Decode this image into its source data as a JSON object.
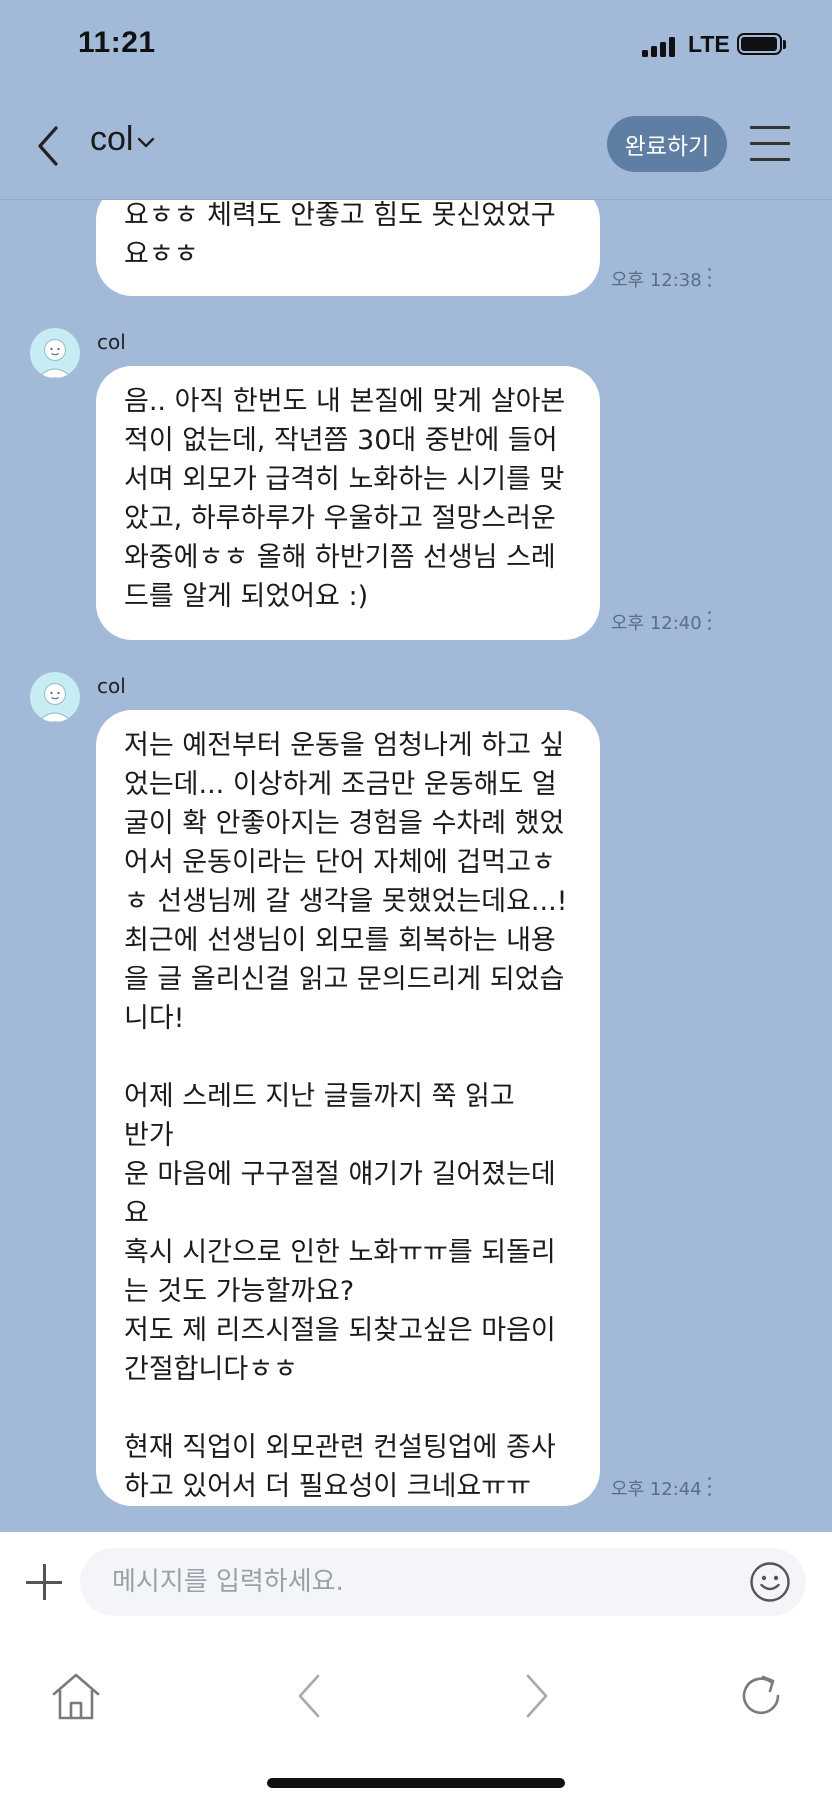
{
  "status_bar": {
    "time": "11:21",
    "network": "LTE",
    "icons": [
      "signal-icon",
      "battery-icon"
    ]
  },
  "header": {
    "back_icon": "chevron-left-icon",
    "title": "col",
    "title_icon": "chevron-down-icon",
    "done_label": "완료하기",
    "menu_icon": "hamburger-icon"
  },
  "messages": [
    {
      "sender": "",
      "text": "요ㅎㅎ 체력도 안좋고 힘도 못신었었구\n요ㅎㅎ",
      "time": "오후 12:38"
    },
    {
      "sender": "col",
      "text": "음.. 아직 한번도 내 본질에 맞게 살아본\n적이 없는데, 작년쯤 30대 중반에 들어\n서며 외모가 급격히 노화하는 시기를 맞\n았고, 하루하루가 우울하고 절망스러운\n와중에ㅎㅎ 올해 하반기쯤 선생님 스레\n드를 알게 되었어요 :)",
      "time": "오후 12:40"
    },
    {
      "sender": "col",
      "text": "저는 예전부터 운동을 엄청나게 하고 싶\n었는데... 이상하게 조금만 운동해도 얼\n굴이 확 안좋아지는 경험을 수차례 했었\n어서 운동이라는 단어 자체에 겁먹고ㅎ\nㅎ 선생님께 갈 생각을 못했었는데요...!\n최근에 선생님이 외모를 회복하는 내용\n을 글 올리신걸 읽고 문의드리게 되었습\n니다!\n\n어제 스레드 지난 글들까지 쭉 읽고 반가\n운 마음에 구구절절 얘기가 길어졌는데\n요\n혹시 시간으로 인한 노화ㅠㅠ를 되돌리\n는 것도 가능할까요?\n저도 제 리즈시절을 되찾고싶은 마음이\n간절합니다ㅎㅎ\n\n현재 직업이 외모관련 컨설팅업에 종사\n하고 있어서 더 필요성이 크네요ㅠㅠ",
      "time": "오후 12:44"
    }
  ],
  "composer": {
    "plus_icon": "plus-icon",
    "placeholder": "메시지를 입력하세요.",
    "emoji_icon": "smiley-icon"
  },
  "browser_nav": {
    "icons": [
      "home-icon",
      "back-arrow-icon",
      "forward-arrow-icon",
      "refresh-icon"
    ]
  },
  "colors": {
    "chat_background": "#a2bad8",
    "done_button": "#5e7ea3",
    "bubble": "#ffffff",
    "avatar": "#c7ecf4"
  }
}
